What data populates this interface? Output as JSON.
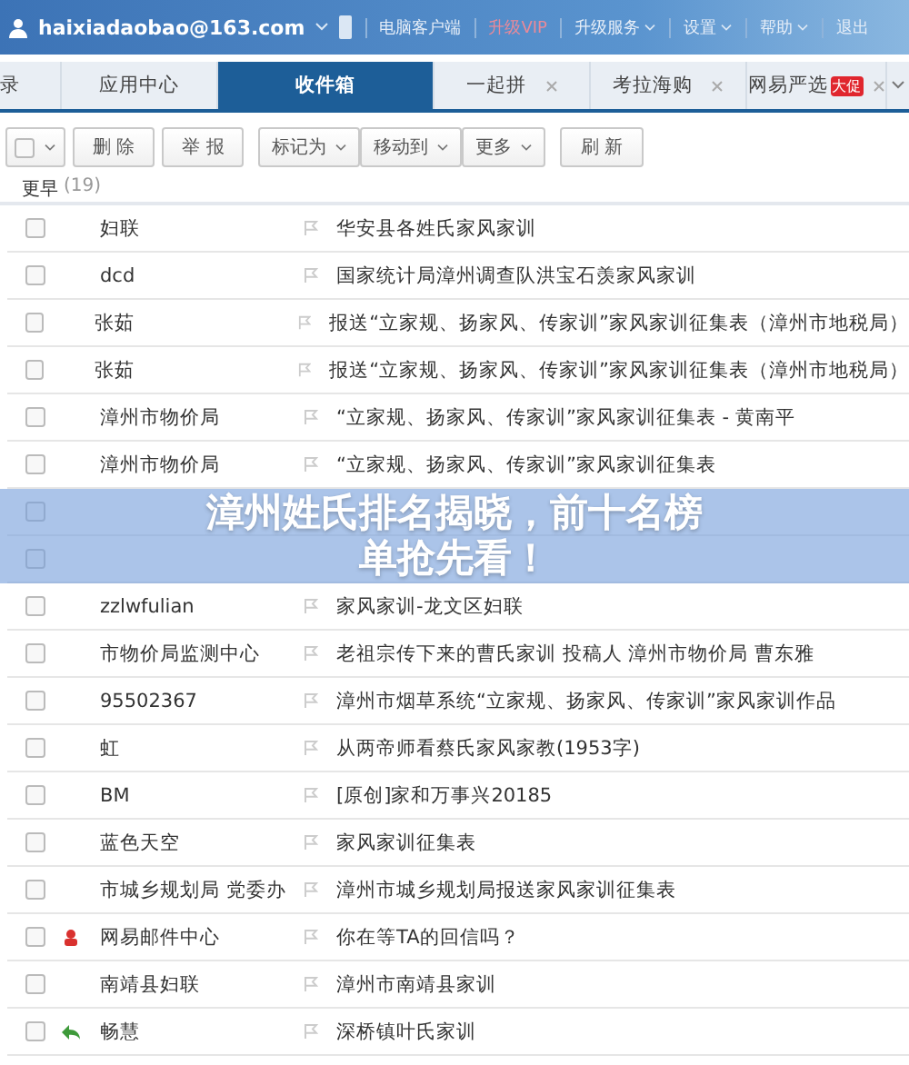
{
  "header": {
    "account": "haixiadaobao@163.com",
    "links": [
      {
        "label": "电脑客户端",
        "kind": "plain"
      },
      {
        "label": "升级VIP",
        "kind": "vip"
      },
      {
        "label": "升级服务",
        "kind": "menu"
      },
      {
        "label": "设置",
        "kind": "menu"
      },
      {
        "label": "帮助",
        "kind": "menu"
      },
      {
        "label": "退出",
        "kind": "plain"
      }
    ]
  },
  "tabs": [
    {
      "label": "录",
      "selected": false,
      "closable": false
    },
    {
      "label": "应用中心",
      "selected": false,
      "closable": false
    },
    {
      "label": "收件箱",
      "selected": true,
      "closable": false
    },
    {
      "label": "一起拼",
      "selected": false,
      "closable": true
    },
    {
      "label": "考拉海购",
      "selected": false,
      "closable": true
    },
    {
      "label": "网易严选",
      "selected": false,
      "closable": true,
      "badge": "大促"
    }
  ],
  "toolbar": {
    "select_all_checked": false,
    "buttons": [
      {
        "label": "删 除",
        "kind": "button"
      },
      {
        "label": "举 报",
        "kind": "button"
      },
      {
        "label": "标记为",
        "kind": "menu"
      },
      {
        "label": "移动到",
        "kind": "menu"
      },
      {
        "label": "更多",
        "kind": "menu"
      },
      {
        "label": "刷 新",
        "kind": "button"
      }
    ]
  },
  "group": {
    "label": "更早",
    "count": "(19)"
  },
  "rows": [
    {
      "checked": false,
      "kind": "normal",
      "sender": "妇联",
      "subject": "华安县各姓氏家风家训"
    },
    {
      "checked": false,
      "kind": "normal",
      "sender": "dcd",
      "subject": "国家统计局漳州调查队洪宝石羡家风家训"
    },
    {
      "checked": false,
      "kind": "normal",
      "sender": "张茹",
      "subject": "报送“立家规、扬家风、传家训”家风家训征集表（漳州市地税局）"
    },
    {
      "checked": false,
      "kind": "normal",
      "sender": "张茹",
      "subject": "报送“立家规、扬家风、传家训”家风家训征集表（漳州市地税局）"
    },
    {
      "checked": false,
      "kind": "normal",
      "sender": "漳州市物价局",
      "subject": " “立家规、扬家风、传家训”家风家训征集表 - 黄南平"
    },
    {
      "checked": false,
      "kind": "normal",
      "sender": "漳州市物价局",
      "subject": " “立家规、扬家风、传家训”家风家训征集表"
    },
    {
      "checked": false,
      "kind": "normal"
    },
    {
      "checked": false,
      "kind": "normal"
    },
    {
      "checked": false,
      "kind": "normal",
      "sender": "zzlwfulian",
      "subject": "家风家训-龙文区妇联"
    },
    {
      "checked": false,
      "kind": "normal",
      "sender": "市物价局监测中心",
      "subject": "老祖宗传下来的曹氏家训 投稿人 漳州市物价局 曹东雅"
    },
    {
      "checked": false,
      "kind": "normal",
      "sender": "95502367",
      "subject": "漳州市烟草系统“立家规、扬家风、传家训”家风家训作品"
    },
    {
      "checked": false,
      "kind": "normal",
      "sender": "虹",
      "subject": "从两帝师看蔡氏家风家教(1953字)"
    },
    {
      "checked": false,
      "kind": "normal",
      "sender": "BM",
      "subject": "[原创]家和万事兴20185"
    },
    {
      "checked": false,
      "kind": "normal",
      "sender": "蓝色天空",
      "subject": "家风家训征集表"
    },
    {
      "checked": false,
      "kind": "normal",
      "sender": "市城乡规划局 党委办",
      "subject": "漳州市城乡规划局报送家风家训征集表"
    },
    {
      "checked": false,
      "kind": "system",
      "sender": "网易邮件中心",
      "subject": "你在等TA的回信吗？"
    },
    {
      "checked": false,
      "kind": "normal",
      "sender": "南靖县妇联",
      "subject": "漳州市南靖县家训"
    },
    {
      "checked": false,
      "kind": "replied",
      "sender": "畅慧",
      "subject": "深桥镇叶氏家训"
    }
  ],
  "banner": {
    "title": "漳州姓氏排名揭晓，前十名榜单抢先看！"
  }
}
